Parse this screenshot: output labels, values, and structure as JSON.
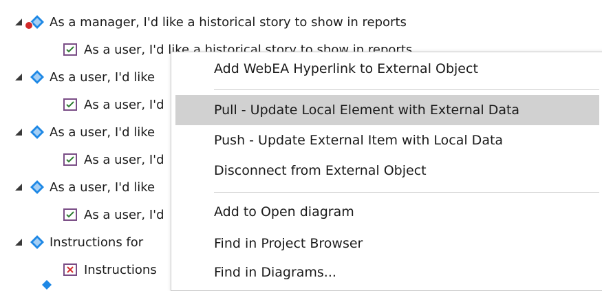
{
  "tree": {
    "rows": [
      {
        "type": "parent",
        "label": "As a manager, I'd like a historical story to show in reports",
        "alert": true
      },
      {
        "type": "child",
        "label": "As a user, I'd like a historical story to show in reports",
        "icon": "check"
      },
      {
        "type": "parent",
        "label": "As a user, I'd like"
      },
      {
        "type": "child",
        "label": "As a user, I'd",
        "icon": "check"
      },
      {
        "type": "parent",
        "label": "As a user, I'd like"
      },
      {
        "type": "child",
        "label": "As a user, I'd",
        "icon": "check"
      },
      {
        "type": "parent",
        "label": "As a user, I'd like"
      },
      {
        "type": "child",
        "label": "As a user, I'd",
        "icon": "check"
      },
      {
        "type": "parent",
        "label": "Instructions for"
      },
      {
        "type": "child",
        "label": "Instructions",
        "icon": "x"
      }
    ]
  },
  "context_menu": {
    "items": [
      {
        "label": "Add WebEA Hyperlink to External Object"
      },
      {
        "label": "Pull - Update Local Element with External Data",
        "highlighted": true
      },
      {
        "label": "Push - Update External Item with Local Data"
      },
      {
        "label": "Disconnect from External Object"
      },
      {
        "label": "Add to Open diagram"
      },
      {
        "label": "Find in Project Browser"
      },
      {
        "label": "Find in Diagrams..."
      }
    ]
  },
  "colors": {
    "diamond": "#1e88e5",
    "highlight": "#d1d1d1",
    "alert": "#d12b2b",
    "check": "#2e7d32",
    "x": "#d32f2f"
  }
}
